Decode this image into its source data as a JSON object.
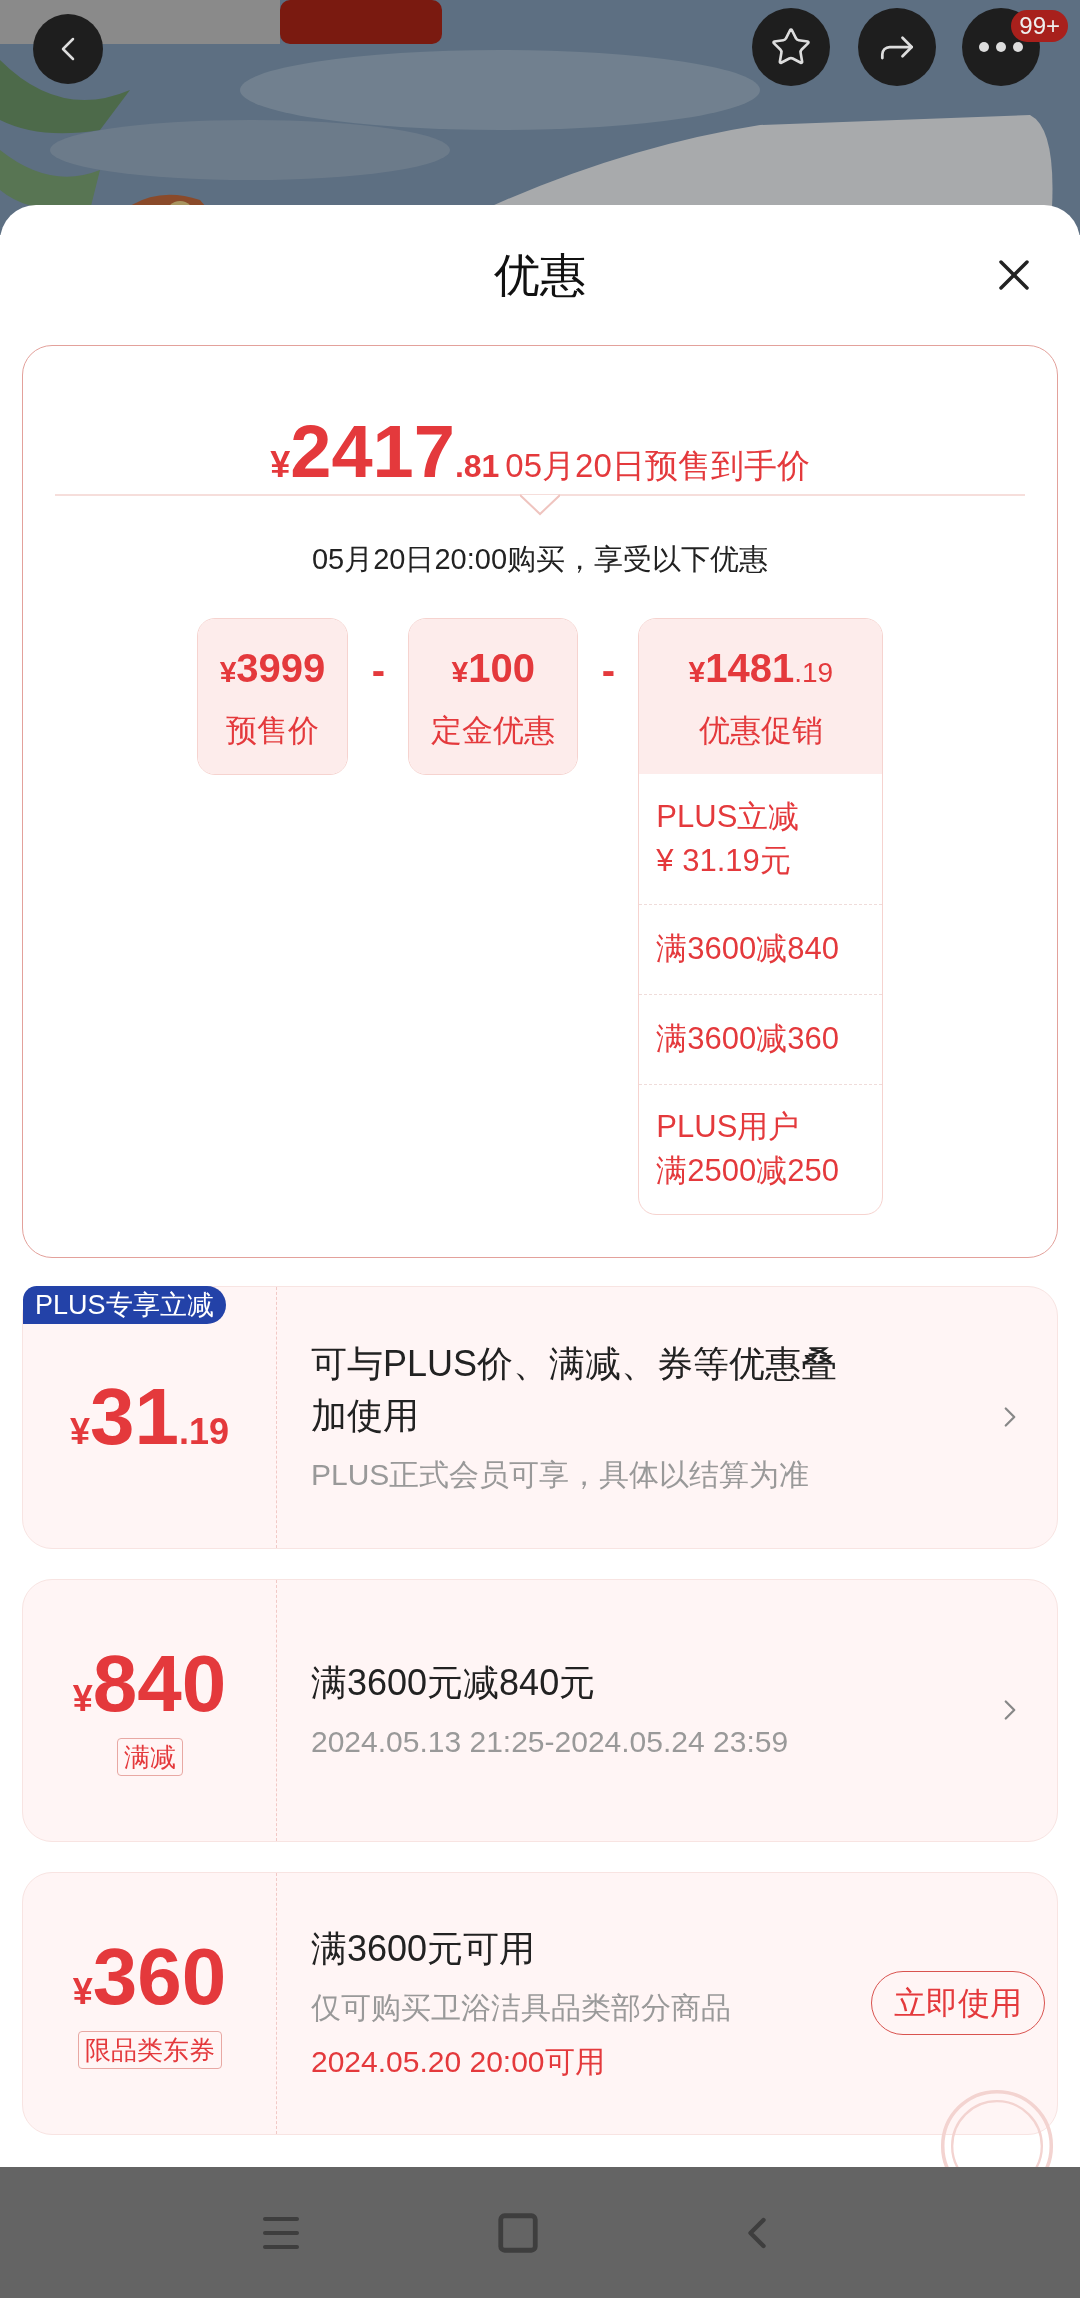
{
  "top_bar": {
    "badge": "99+"
  },
  "sheet": {
    "title": "优惠"
  },
  "summary": {
    "currency": "¥",
    "price_int": "2417",
    "price_dec": ".81",
    "caption": "05月20日预售到手价",
    "purchase_note": "05月20日20:00购买，享受以下优惠",
    "terms": [
      {
        "currency": "¥",
        "amount": "3999",
        "label": "预售价"
      },
      {
        "operator": "-",
        "currency": "¥",
        "amount": "100",
        "label": "定金优惠"
      },
      {
        "operator": "-",
        "currency": "¥",
        "amount": "1481",
        "decimals": ".19",
        "label": "优惠促销",
        "details": [
          [
            "PLUS立减",
            "¥ 31.19元"
          ],
          [
            "满3600减840"
          ],
          [
            "满3600减360"
          ],
          [
            "PLUS用户",
            "满2500减250"
          ]
        ]
      }
    ]
  },
  "coupons": [
    {
      "kind": "plus",
      "tag": "PLUS专享立减",
      "currency": "¥",
      "amount": "31",
      "decimals": ".19",
      "title": "可与PLUS价、满减、券等优惠叠加使用",
      "subtitle": "PLUS正式会员可享，具体以结算为准",
      "chevron": true
    },
    {
      "kind": "discount",
      "currency": "¥",
      "amount": "840",
      "label": "满减",
      "title": "满3600元减840元",
      "subtitle": "2024.05.13 21:25-2024.05.24 23:59",
      "chevron": true
    },
    {
      "kind": "coupon",
      "currency": "¥",
      "amount": "360",
      "label": "限品类东券",
      "title": "满3600元可用",
      "subtitle": "仅可购买卫浴洁具品类部分商品",
      "note": "2024.05.20 20:00可用",
      "chevron": false,
      "button": "立即使用"
    }
  ]
}
